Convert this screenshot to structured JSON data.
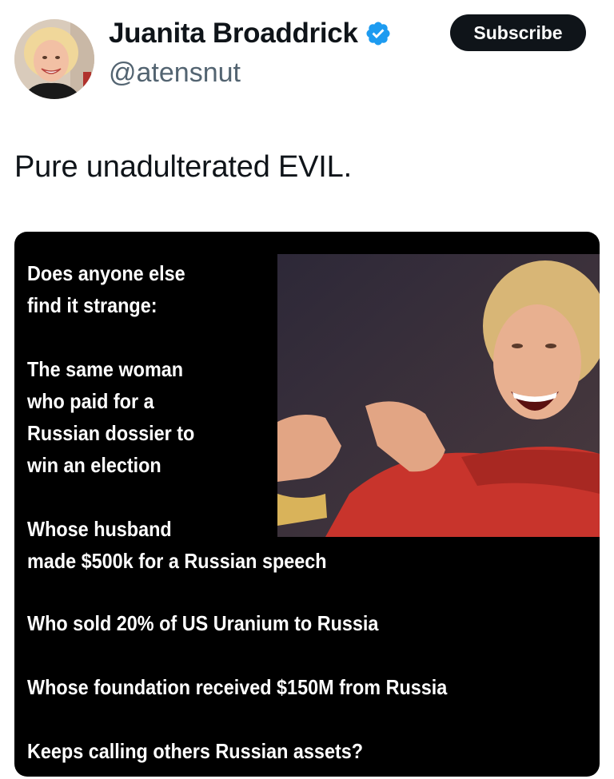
{
  "header": {
    "display_name": "Juanita Broaddrick",
    "handle": "@atensnut",
    "subscribe_label": "Subscribe"
  },
  "tweet": {
    "text": "Pure unadulterated EVIL."
  },
  "meme": {
    "block1": [
      "Does anyone else",
      "find it strange:"
    ],
    "block2": [
      "The same woman",
      "who paid for a",
      "Russian dossier to",
      "win an election"
    ],
    "block3": [
      "Whose husband",
      "made $500k for a Russian speech"
    ],
    "line4": "Who sold 20% of US Uranium to Russia",
    "line5": "Whose foundation received $150M from Russia",
    "line6": "Keeps calling others Russian assets?"
  },
  "icons": {
    "verified": "verified-badge-icon"
  },
  "colors": {
    "verified_blue": "#1d9bf0",
    "button_bg": "#0f1419",
    "handle_gray": "#536471"
  }
}
